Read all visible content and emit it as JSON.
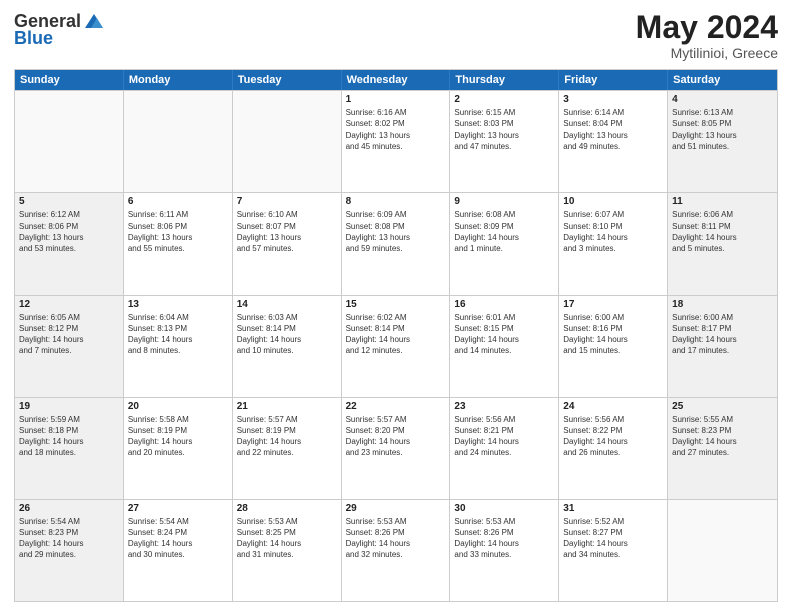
{
  "header": {
    "logo_general": "General",
    "logo_blue": "Blue",
    "month_title": "May 2024",
    "location": "Mytilinioi, Greece"
  },
  "weekdays": [
    "Sunday",
    "Monday",
    "Tuesday",
    "Wednesday",
    "Thursday",
    "Friday",
    "Saturday"
  ],
  "weeks": [
    [
      {
        "day": "",
        "text": "",
        "empty": true
      },
      {
        "day": "",
        "text": "",
        "empty": true
      },
      {
        "day": "",
        "text": "",
        "empty": true
      },
      {
        "day": "1",
        "text": "Sunrise: 6:16 AM\nSunset: 8:02 PM\nDaylight: 13 hours\nand 45 minutes.",
        "empty": false
      },
      {
        "day": "2",
        "text": "Sunrise: 6:15 AM\nSunset: 8:03 PM\nDaylight: 13 hours\nand 47 minutes.",
        "empty": false
      },
      {
        "day": "3",
        "text": "Sunrise: 6:14 AM\nSunset: 8:04 PM\nDaylight: 13 hours\nand 49 minutes.",
        "empty": false
      },
      {
        "day": "4",
        "text": "Sunrise: 6:13 AM\nSunset: 8:05 PM\nDaylight: 13 hours\nand 51 minutes.",
        "empty": false,
        "shaded": true
      }
    ],
    [
      {
        "day": "5",
        "text": "Sunrise: 6:12 AM\nSunset: 8:06 PM\nDaylight: 13 hours\nand 53 minutes.",
        "empty": false,
        "shaded": true
      },
      {
        "day": "6",
        "text": "Sunrise: 6:11 AM\nSunset: 8:06 PM\nDaylight: 13 hours\nand 55 minutes.",
        "empty": false
      },
      {
        "day": "7",
        "text": "Sunrise: 6:10 AM\nSunset: 8:07 PM\nDaylight: 13 hours\nand 57 minutes.",
        "empty": false
      },
      {
        "day": "8",
        "text": "Sunrise: 6:09 AM\nSunset: 8:08 PM\nDaylight: 13 hours\nand 59 minutes.",
        "empty": false
      },
      {
        "day": "9",
        "text": "Sunrise: 6:08 AM\nSunset: 8:09 PM\nDaylight: 14 hours\nand 1 minute.",
        "empty": false
      },
      {
        "day": "10",
        "text": "Sunrise: 6:07 AM\nSunset: 8:10 PM\nDaylight: 14 hours\nand 3 minutes.",
        "empty": false
      },
      {
        "day": "11",
        "text": "Sunrise: 6:06 AM\nSunset: 8:11 PM\nDaylight: 14 hours\nand 5 minutes.",
        "empty": false,
        "shaded": true
      }
    ],
    [
      {
        "day": "12",
        "text": "Sunrise: 6:05 AM\nSunset: 8:12 PM\nDaylight: 14 hours\nand 7 minutes.",
        "empty": false,
        "shaded": true
      },
      {
        "day": "13",
        "text": "Sunrise: 6:04 AM\nSunset: 8:13 PM\nDaylight: 14 hours\nand 8 minutes.",
        "empty": false
      },
      {
        "day": "14",
        "text": "Sunrise: 6:03 AM\nSunset: 8:14 PM\nDaylight: 14 hours\nand 10 minutes.",
        "empty": false
      },
      {
        "day": "15",
        "text": "Sunrise: 6:02 AM\nSunset: 8:14 PM\nDaylight: 14 hours\nand 12 minutes.",
        "empty": false
      },
      {
        "day": "16",
        "text": "Sunrise: 6:01 AM\nSunset: 8:15 PM\nDaylight: 14 hours\nand 14 minutes.",
        "empty": false
      },
      {
        "day": "17",
        "text": "Sunrise: 6:00 AM\nSunset: 8:16 PM\nDaylight: 14 hours\nand 15 minutes.",
        "empty": false
      },
      {
        "day": "18",
        "text": "Sunrise: 6:00 AM\nSunset: 8:17 PM\nDaylight: 14 hours\nand 17 minutes.",
        "empty": false,
        "shaded": true
      }
    ],
    [
      {
        "day": "19",
        "text": "Sunrise: 5:59 AM\nSunset: 8:18 PM\nDaylight: 14 hours\nand 18 minutes.",
        "empty": false,
        "shaded": true
      },
      {
        "day": "20",
        "text": "Sunrise: 5:58 AM\nSunset: 8:19 PM\nDaylight: 14 hours\nand 20 minutes.",
        "empty": false
      },
      {
        "day": "21",
        "text": "Sunrise: 5:57 AM\nSunset: 8:19 PM\nDaylight: 14 hours\nand 22 minutes.",
        "empty": false
      },
      {
        "day": "22",
        "text": "Sunrise: 5:57 AM\nSunset: 8:20 PM\nDaylight: 14 hours\nand 23 minutes.",
        "empty": false
      },
      {
        "day": "23",
        "text": "Sunrise: 5:56 AM\nSunset: 8:21 PM\nDaylight: 14 hours\nand 24 minutes.",
        "empty": false
      },
      {
        "day": "24",
        "text": "Sunrise: 5:56 AM\nSunset: 8:22 PM\nDaylight: 14 hours\nand 26 minutes.",
        "empty": false
      },
      {
        "day": "25",
        "text": "Sunrise: 5:55 AM\nSunset: 8:23 PM\nDaylight: 14 hours\nand 27 minutes.",
        "empty": false,
        "shaded": true
      }
    ],
    [
      {
        "day": "26",
        "text": "Sunrise: 5:54 AM\nSunset: 8:23 PM\nDaylight: 14 hours\nand 29 minutes.",
        "empty": false,
        "shaded": true
      },
      {
        "day": "27",
        "text": "Sunrise: 5:54 AM\nSunset: 8:24 PM\nDaylight: 14 hours\nand 30 minutes.",
        "empty": false
      },
      {
        "day": "28",
        "text": "Sunrise: 5:53 AM\nSunset: 8:25 PM\nDaylight: 14 hours\nand 31 minutes.",
        "empty": false
      },
      {
        "day": "29",
        "text": "Sunrise: 5:53 AM\nSunset: 8:26 PM\nDaylight: 14 hours\nand 32 minutes.",
        "empty": false
      },
      {
        "day": "30",
        "text": "Sunrise: 5:53 AM\nSunset: 8:26 PM\nDaylight: 14 hours\nand 33 minutes.",
        "empty": false
      },
      {
        "day": "31",
        "text": "Sunrise: 5:52 AM\nSunset: 8:27 PM\nDaylight: 14 hours\nand 34 minutes.",
        "empty": false
      },
      {
        "day": "",
        "text": "",
        "empty": true,
        "shaded": true
      }
    ]
  ]
}
